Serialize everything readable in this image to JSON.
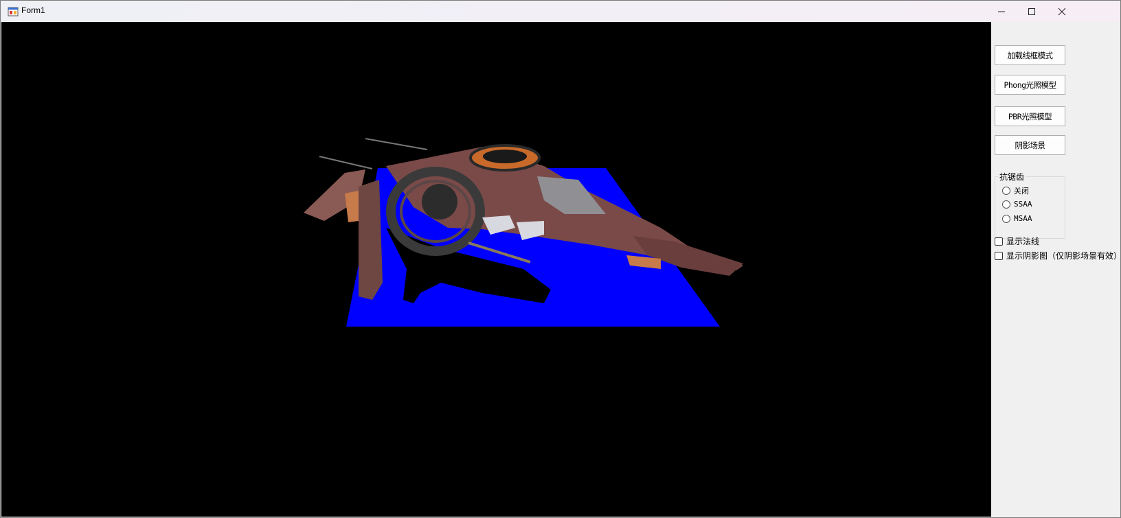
{
  "window": {
    "title": "Form1",
    "controls": {
      "minimize": "minimize-icon",
      "maximize": "maximize-icon",
      "close": "close-icon"
    }
  },
  "viewport": {
    "background": "#000000",
    "ground_plane_color": "#0000ff",
    "model_description_icon": "spaceship-model"
  },
  "panel": {
    "buttons": [
      {
        "label": "加载线框模式"
      },
      {
        "label": "Phong光照模型"
      },
      {
        "label": "PBR光照模型"
      },
      {
        "label": "阴影场景"
      }
    ],
    "antialias": {
      "title": "抗锯齿",
      "options": [
        {
          "label": "关闭",
          "selected": false
        },
        {
          "label": "SSAA",
          "selected": false
        },
        {
          "label": "MSAA",
          "selected": false
        }
      ]
    },
    "checkboxes": [
      {
        "label": "显示法线",
        "checked": false
      },
      {
        "label": "显示阴影图（仅阴影场景有效）",
        "checked": false
      }
    ]
  }
}
